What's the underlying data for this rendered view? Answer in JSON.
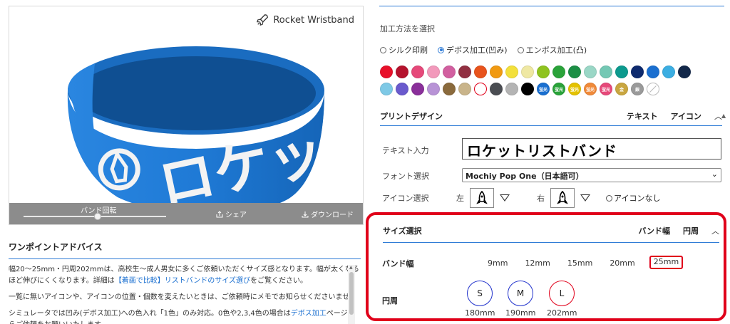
{
  "brand": {
    "name": "Rocket Wristband"
  },
  "preview": {
    "band_text": "ロケッ",
    "band_color": "#1f7ad6",
    "toolbar": {
      "rotate_label": "バンド回転",
      "rotate_value": 0.52,
      "share_label": "シェア",
      "download_label": "ダウンロード"
    }
  },
  "advice": {
    "title": "ワンポイントアドバイス",
    "p1a": "幅20〜25mm・円周202mmは、高校生〜成人男女に多くご依頼いただくサイズ感となります。幅が太くなるほど伸びにくくなります。詳細は",
    "p1_link": "【着画で比較】リストバンドのサイズ選び",
    "p1b": "をご覧ください。",
    "p2": "一覧に無いアイコンや、アイコンの位置・個数を変えたいときは、ご依頼時にメモでお知らせくださいませ。",
    "p3a": "シミュレータでは凹み(デボス加工)への色入れ「1色」のみ対応。0色や2,3,4色の場合は",
    "p3_link": "デボス加工",
    "p3b": "ページからご依頼をお願いいたします。"
  },
  "processing": {
    "label": "加工方法を選択",
    "options": [
      {
        "label": "シルク印刷",
        "selected": false
      },
      {
        "label": "デボス加工(凹み)",
        "selected": true
      },
      {
        "label": "エンボス加工(凸)",
        "selected": false
      }
    ]
  },
  "colors_row1": [
    "#e8102a",
    "#b5122d",
    "#e6497a",
    "#f299bb",
    "#d25fa0",
    "#923042",
    "#e8531c",
    "#f19a12",
    "#f3e03b",
    "#efe8a3",
    "#8fc31f",
    "#2aa33a",
    "#1c8f45",
    "#9ad7c6",
    "#74c8b4",
    "#0c9a8e",
    "#0e2a6e",
    "#1a6fd0",
    "#3caee2",
    "#13284a"
  ],
  "colors_row2": [
    {
      "c": "#7ec9e6",
      "t": ""
    },
    {
      "c": "#6a5acd",
      "t": ""
    },
    {
      "c": "#8a2f9a",
      "t": ""
    },
    {
      "c": "#b893d6",
      "t": ""
    },
    {
      "c": "#8a6a3c",
      "t": ""
    },
    {
      "c": "#c9b48a",
      "t": ""
    },
    {
      "c": "#ffffff",
      "t": "",
      "ring": "#e0001a"
    },
    {
      "c": "#4a4d52",
      "t": ""
    },
    {
      "c": "#b4b4b4",
      "t": ""
    },
    {
      "c": "#000000",
      "t": ""
    },
    {
      "c": "#1a6fd0",
      "t": "蛍光"
    },
    {
      "c": "#2aa33a",
      "t": "蛍光"
    },
    {
      "c": "#e4c200",
      "t": "蛍光"
    },
    {
      "c": "#f08a3a",
      "t": "蛍光"
    },
    {
      "c": "#e6497a",
      "t": "蛍光"
    },
    {
      "c": "#c9a640",
      "t": "金"
    },
    {
      "c": "#9a9a9a",
      "t": "銀"
    },
    {
      "c": "#ffffff",
      "t": "",
      "none": true
    }
  ],
  "print_design": {
    "title": "プリントデザイン",
    "tab_text": "テキスト",
    "tab_icon": "アイコン"
  },
  "text_input": {
    "label": "テキスト入力",
    "value": "ロケットリストバンド"
  },
  "font_select": {
    "label": "フォント選択",
    "value": "Mochiy Pop One（日本語可）"
  },
  "icon_select": {
    "label": "アイコン選択",
    "left": "左",
    "right": "右",
    "no_icon": "アイコンなし"
  },
  "size": {
    "title": "サイズ選択",
    "tab_width": "バンド幅",
    "tab_circ": "円周",
    "width_label": "バンド幅",
    "widths": [
      "9mm",
      "12mm",
      "15mm",
      "20mm",
      "25mm"
    ],
    "selected_width": "25mm",
    "circ_label": "円周",
    "circs": [
      {
        "letter": "S",
        "mm": "180mm"
      },
      {
        "letter": "M",
        "mm": "190mm"
      },
      {
        "letter": "L",
        "mm": "202mm"
      }
    ],
    "selected_circ": "L"
  }
}
